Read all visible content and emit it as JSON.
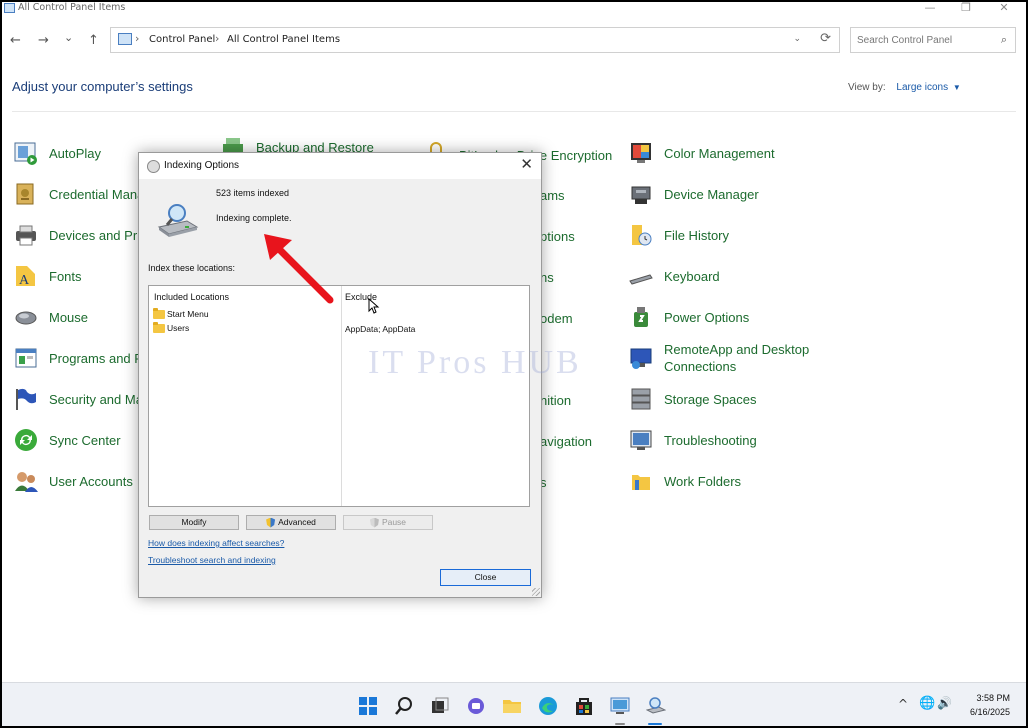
{
  "window": {
    "title": "All Control Panel Items",
    "controls": {
      "minimize": "—",
      "maximize": "❐",
      "close": "✕"
    }
  },
  "navbar": {
    "back": "←",
    "forward": "→",
    "recent": "⌄",
    "up": "↑",
    "breadcrumb": [
      "Control Panel",
      "All Control Panel Items"
    ],
    "breadcrumb_sep": "›",
    "dropdown": "⌄",
    "refresh": "⟳",
    "search_placeholder": "Search Control Panel",
    "search_icon": "⌕"
  },
  "header": {
    "title": "Adjust your computer’s settings",
    "view_by_label": "View by:",
    "view_by_value": "Large icons",
    "view_by_caret": "▼"
  },
  "items": [
    {
      "label": "AutoPlay",
      "icon": "autoplay-icon"
    },
    {
      "label": "Credential Mana",
      "icon": "credential-manager-icon"
    },
    {
      "label": "Devices and Prir",
      "icon": "devices-printers-icon"
    },
    {
      "label": "Fonts",
      "icon": "fonts-icon"
    },
    {
      "label": "Mouse",
      "icon": "mouse-icon"
    },
    {
      "label": "Programs and F",
      "icon": "programs-features-icon"
    },
    {
      "label": "Security and Ma",
      "icon": "security-maintenance-icon"
    },
    {
      "label": "Sync Center",
      "icon": "sync-center-icon"
    },
    {
      "label": "User Accounts",
      "icon": "user-accounts-icon"
    },
    {
      "label": "Backup and Restore",
      "icon": "backup-restore-icon"
    },
    {
      "label": "BitLocker Drive Encryption",
      "icon": "bitlocker-icon"
    },
    {
      "label": "ams",
      "icon": ""
    },
    {
      "label": "ptions",
      "icon": ""
    },
    {
      "label": "ns",
      "icon": ""
    },
    {
      "label": "odem",
      "icon": ""
    },
    {
      "label": "nition",
      "icon": ""
    },
    {
      "label": "avigation",
      "icon": ""
    },
    {
      "label": "s",
      "icon": ""
    },
    {
      "label": "Color Management",
      "icon": "color-management-icon"
    },
    {
      "label": "Device Manager",
      "icon": "device-manager-icon"
    },
    {
      "label": "File History",
      "icon": "file-history-icon"
    },
    {
      "label": "Keyboard",
      "icon": "keyboard-icon"
    },
    {
      "label": "Power Options",
      "icon": "power-options-icon"
    },
    {
      "label": "RemoteApp and Desktop Connections",
      "icon": "remoteapp-icon"
    },
    {
      "label": "Storage Spaces",
      "icon": "storage-spaces-icon"
    },
    {
      "label": "Troubleshooting",
      "icon": "troubleshooting-icon"
    },
    {
      "label": "Work Folders",
      "icon": "work-folders-icon"
    }
  ],
  "dialog": {
    "title": "Indexing Options",
    "close": "✕",
    "items_count": "523 items indexed",
    "status": "Indexing complete.",
    "index_label": "Index these locations:",
    "included_header": "Included Locations",
    "exclude_header": "Exclude",
    "locations": [
      "Start Menu",
      "Users"
    ],
    "exclude_value": "AppData; AppData",
    "buttons": {
      "modify": "Modify",
      "advanced": "Advanced",
      "pause": "Pause",
      "close": "Close"
    },
    "links": {
      "affect": "How does indexing affect searches?",
      "troubleshoot": "Troubleshoot search and indexing"
    }
  },
  "watermark": "IT Pros HUB",
  "taskbar": {
    "time": "3:58 PM",
    "date": "6/16/2025",
    "tray_chevron": "^",
    "tray_network": "🌐",
    "tray_volume": "🔊",
    "icons": [
      "start-icon",
      "search-icon",
      "task-view-icon",
      "chat-icon",
      "file-explorer-icon",
      "edge-icon",
      "store-icon",
      "control-panel-icon",
      "indexing-icon"
    ]
  },
  "colors": {
    "item_link": "#1c6b2e",
    "heading": "#1a3d78",
    "link": "#1a5aa8",
    "arrow": "#e8141c"
  }
}
